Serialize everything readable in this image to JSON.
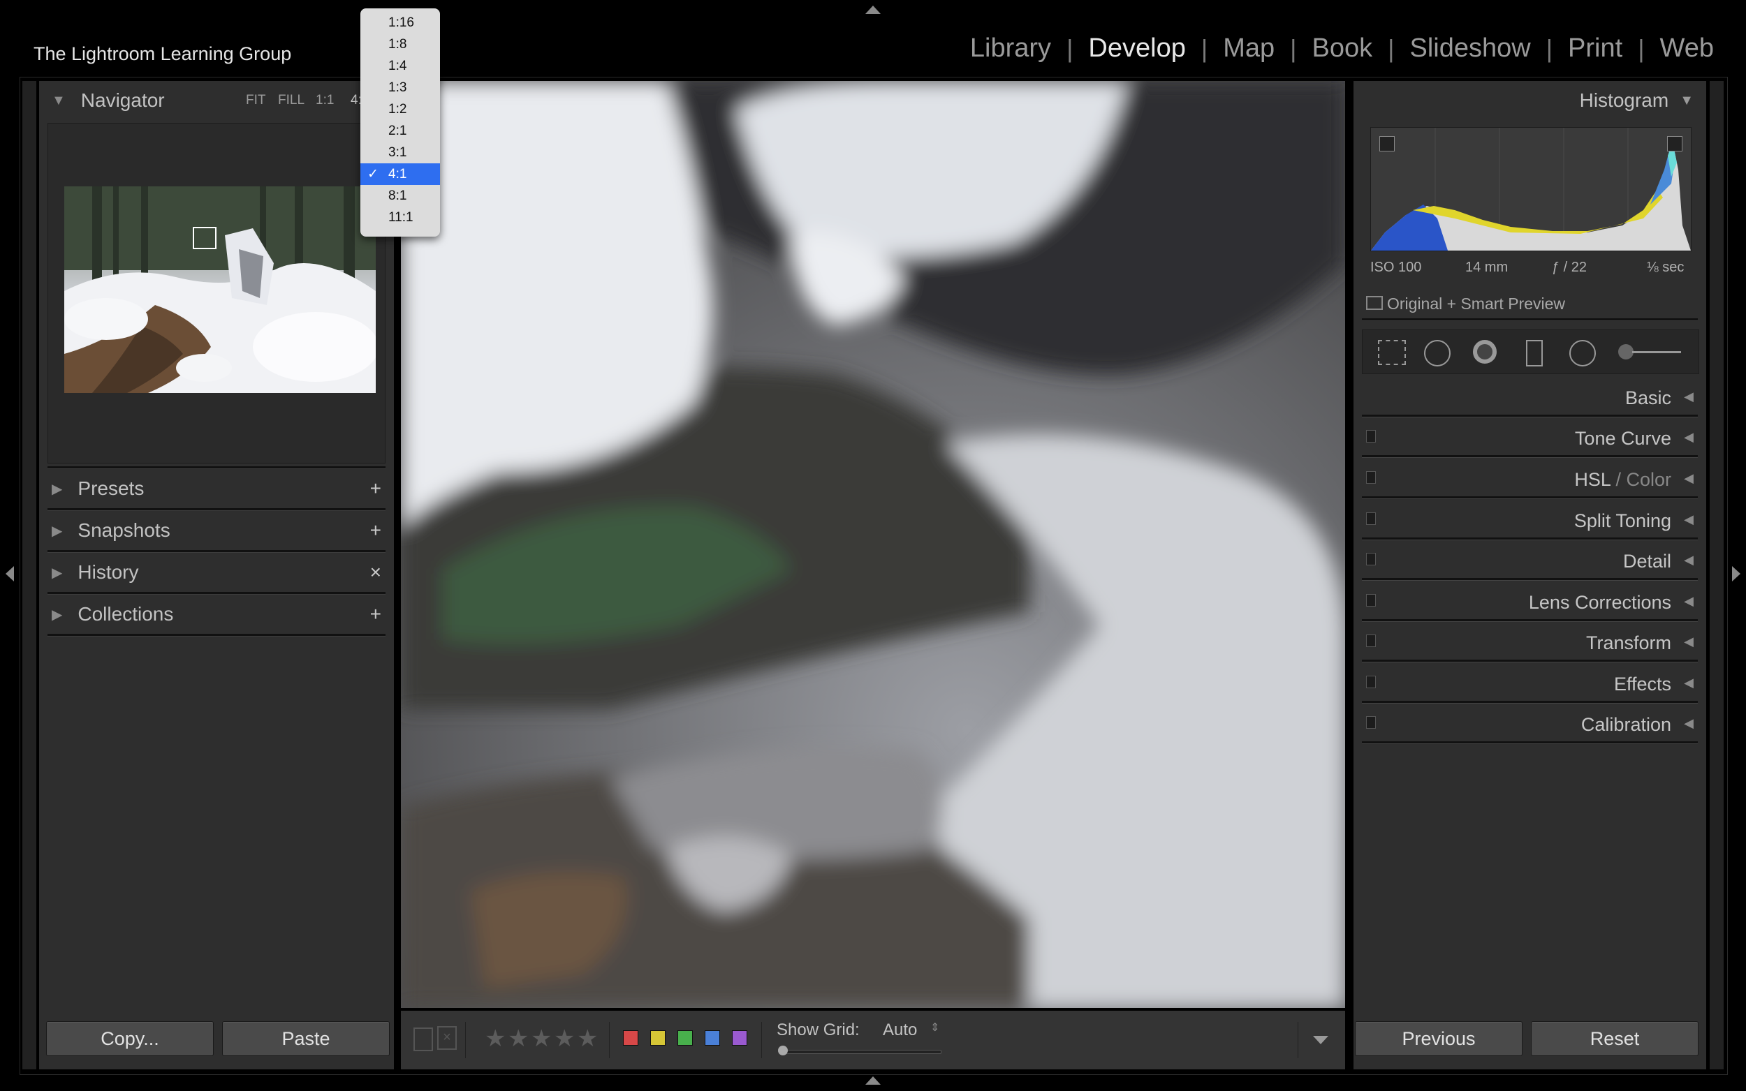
{
  "identity_plate": "The Lightroom Learning Group",
  "modules": [
    {
      "label": "Library",
      "active": false
    },
    {
      "label": "Develop",
      "active": true
    },
    {
      "label": "Map",
      "active": false
    },
    {
      "label": "Book",
      "active": false
    },
    {
      "label": "Slideshow",
      "active": false
    },
    {
      "label": "Print",
      "active": false
    },
    {
      "label": "Web",
      "active": false
    }
  ],
  "navigator": {
    "title": "Navigator",
    "zoom_options": [
      "FIT",
      "FILL",
      "1:1",
      "4:"
    ]
  },
  "zoom_menu": {
    "items": [
      "1:16",
      "1:8",
      "1:4",
      "1:3",
      "1:2",
      "2:1",
      "3:1",
      "4:1",
      "8:1",
      "11:1"
    ],
    "selected": "4:1",
    "check": "✓"
  },
  "left_panels": [
    {
      "label": "Presets",
      "action": "+"
    },
    {
      "label": "Snapshots",
      "action": "+"
    },
    {
      "label": "History",
      "action": "×"
    },
    {
      "label": "Collections",
      "action": "+"
    }
  ],
  "left_buttons": {
    "copy": "Copy...",
    "paste": "Paste"
  },
  "histogram": {
    "title": "Histogram",
    "iso": "ISO 100",
    "focal": "14 mm",
    "aperture": "ƒ / 22",
    "shutter": "⅛ sec",
    "preview_status": "Original + Smart Preview"
  },
  "right_panels": {
    "basic": "Basic",
    "tone_curve": "Tone Curve",
    "hsl": "HSL",
    "hsl_sep": " / ",
    "color": "Color",
    "split_toning": "Split Toning",
    "detail": "Detail",
    "lens_corrections": "Lens Corrections",
    "transform": "Transform",
    "effects": "Effects",
    "calibration": "Calibration"
  },
  "right_buttons": {
    "previous": "Previous",
    "reset": "Reset"
  },
  "toolbar": {
    "stars": "★",
    "show_grid_label": "Show Grid:",
    "show_grid_value": "Auto",
    "grid_slider_value": 0
  },
  "colors": {
    "label_red": "#d84848",
    "label_yellow": "#d6c636",
    "label_green": "#48b04c",
    "label_blue": "#4a80d8",
    "label_purple": "#9a5ad0",
    "menu_selection": "#2e6ef0"
  }
}
